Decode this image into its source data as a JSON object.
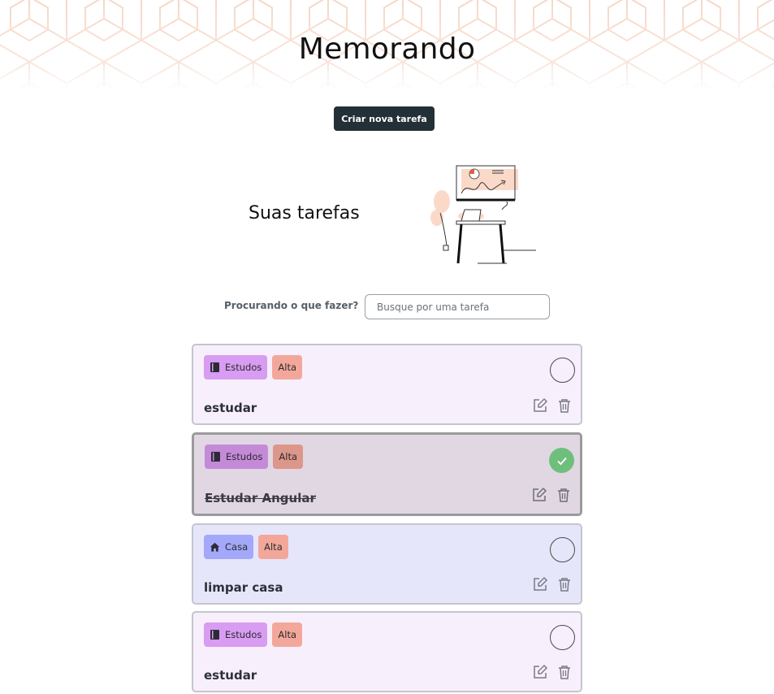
{
  "app": {
    "title": "Memorando"
  },
  "toolbar": {
    "new_task_label": "Criar nova tarefa"
  },
  "section": {
    "title": "Suas tarefas"
  },
  "search": {
    "label": "Procurando o que fazer?",
    "placeholder": "Busque por uma tarefa",
    "value": ""
  },
  "colors": {
    "accent_dark": "#233038",
    "done_check": "#6fbf7c",
    "pattern": "#f6d8c8"
  },
  "tasks": [
    {
      "category": "Estudos",
      "category_icon": "book-icon",
      "priority": "Alta",
      "title": "estudar",
      "done": false,
      "card_color": "#f7effc"
    },
    {
      "category": "Estudos",
      "category_icon": "book-icon",
      "priority": "Alta",
      "title": "Estudar Angular",
      "done": true,
      "card_color": "#e1d7e3"
    },
    {
      "category": "Casa",
      "category_icon": "home-icon",
      "priority": "Alta",
      "title": "limpar casa",
      "done": false,
      "card_color": "#e6e6fb"
    },
    {
      "category": "Estudos",
      "category_icon": "book-icon",
      "priority": "Alta",
      "title": "estudar",
      "done": false,
      "card_color": "#f7effc"
    }
  ]
}
